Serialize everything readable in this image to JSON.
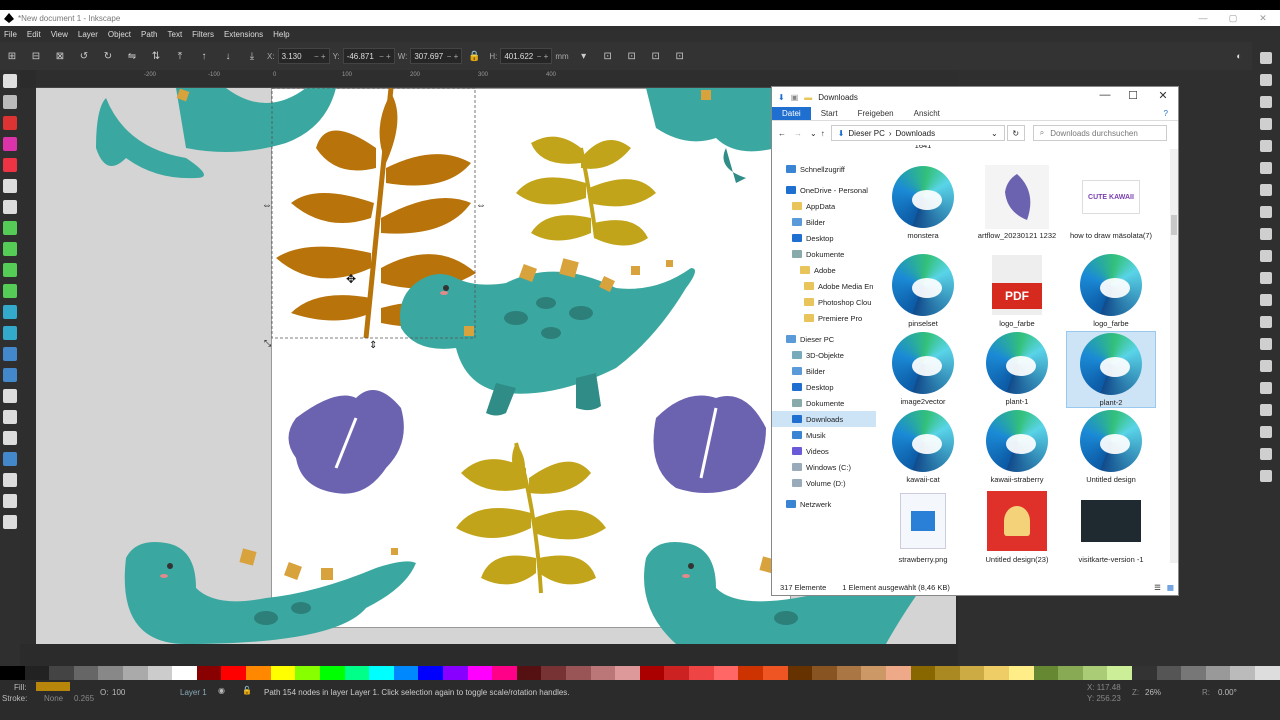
{
  "window": {
    "title": "*New document 1 - Inkscape"
  },
  "menu": [
    "File",
    "Edit",
    "View",
    "Layer",
    "Object",
    "Path",
    "Text",
    "Filters",
    "Extensions",
    "Help"
  ],
  "controls": {
    "x_label": "X:",
    "x_value": "3.130",
    "y_label": "Y:",
    "y_value": "-46.871",
    "w_label": "W:",
    "w_value": "307.697",
    "h_label": "H:",
    "h_value": "401.622",
    "unit": "mm"
  },
  "ruler_h": [
    "-200",
    "-100",
    "0",
    "100",
    "200",
    "300",
    "400"
  ],
  "status": {
    "fill_label": "Fill:",
    "stroke_label": "Stroke:",
    "stroke_value": "None",
    "stroke_width": "0.265",
    "opacity_label": "O:",
    "opacity_value": "100",
    "layer": "Layer 1",
    "message": "Path 154 nodes in layer Layer 1. Click selection again to toggle scale/rotation handles.",
    "x_coord": "X: 117.48",
    "y_coord": "Y: 256.23",
    "zoom_label": "Z:",
    "zoom_value": "26%",
    "rotation_label": "R:",
    "rotation_value": "0.00°"
  },
  "colors": {
    "fill": "#b8860b",
    "teal": "#3aa8a0",
    "ochre": "#c2a41b",
    "purple": "#6b63b0",
    "orange": "#b8730a"
  },
  "explorer": {
    "title": "Downloads",
    "ribbon": [
      "Datei",
      "Start",
      "Freigeben",
      "Ansicht"
    ],
    "breadcrumb": [
      "Dieser PC",
      "Downloads"
    ],
    "search_placeholder": "Downloads durchsuchen",
    "nav": [
      {
        "label": "Schnellzugriff",
        "icon": "star"
      },
      {
        "label": "OneDrive - Personal",
        "icon": "cloud"
      },
      {
        "label": "AppData",
        "icon": "folder"
      },
      {
        "label": "Bilder",
        "icon": "folder"
      },
      {
        "label": "Desktop",
        "icon": "folder"
      },
      {
        "label": "Dokumente",
        "icon": "folder"
      },
      {
        "label": "Adobe",
        "icon": "folder"
      },
      {
        "label": "Adobe Media En",
        "icon": "folder"
      },
      {
        "label": "Photoshop Clou",
        "icon": "folder"
      },
      {
        "label": "Premiere Pro",
        "icon": "folder"
      },
      {
        "label": "Dieser PC",
        "icon": "pc"
      },
      {
        "label": "3D-Objekte",
        "icon": "folder"
      },
      {
        "label": "Bilder",
        "icon": "folder"
      },
      {
        "label": "Desktop",
        "icon": "folder"
      },
      {
        "label": "Dokumente",
        "icon": "folder"
      },
      {
        "label": "Downloads",
        "icon": "download"
      },
      {
        "label": "Musik",
        "icon": "music"
      },
      {
        "label": "Videos",
        "icon": "video"
      },
      {
        "label": "Windows (C:)",
        "icon": "drive"
      },
      {
        "label": "Volume (D:)",
        "icon": "drive"
      },
      {
        "label": "Netzwerk",
        "icon": "network"
      }
    ],
    "top_partial": [
      "1641"
    ],
    "files": [
      {
        "name": "monstera",
        "kind": "edge"
      },
      {
        "name": "artflow_20230121 1232",
        "kind": "artflow"
      },
      {
        "name": "how to draw mäsolata(7)",
        "kind": "cute"
      },
      {
        "name": "pinselset",
        "kind": "edge"
      },
      {
        "name": "logo_farbe",
        "kind": "pdf"
      },
      {
        "name": "logo_farbe",
        "kind": "edge"
      },
      {
        "name": "image2vector",
        "kind": "edge"
      },
      {
        "name": "plant-1",
        "kind": "edge"
      },
      {
        "name": "plant-2",
        "kind": "edge",
        "selected": true
      },
      {
        "name": "kawaii-cat",
        "kind": "edge"
      },
      {
        "name": "kawaii-straberry",
        "kind": "edge"
      },
      {
        "name": "Untitled design",
        "kind": "edge"
      },
      {
        "name": "strawberry.png",
        "kind": "png"
      },
      {
        "name": "Untitled design(23)",
        "kind": "red"
      },
      {
        "name": "visitkarte-version -1",
        "kind": "dark"
      }
    ],
    "pdf_label": "PDF",
    "cute_label": "CUTE KAWAII",
    "status_count": "317 Elemente",
    "status_selected": "1 Element ausgewählt (8,46 KB)"
  }
}
